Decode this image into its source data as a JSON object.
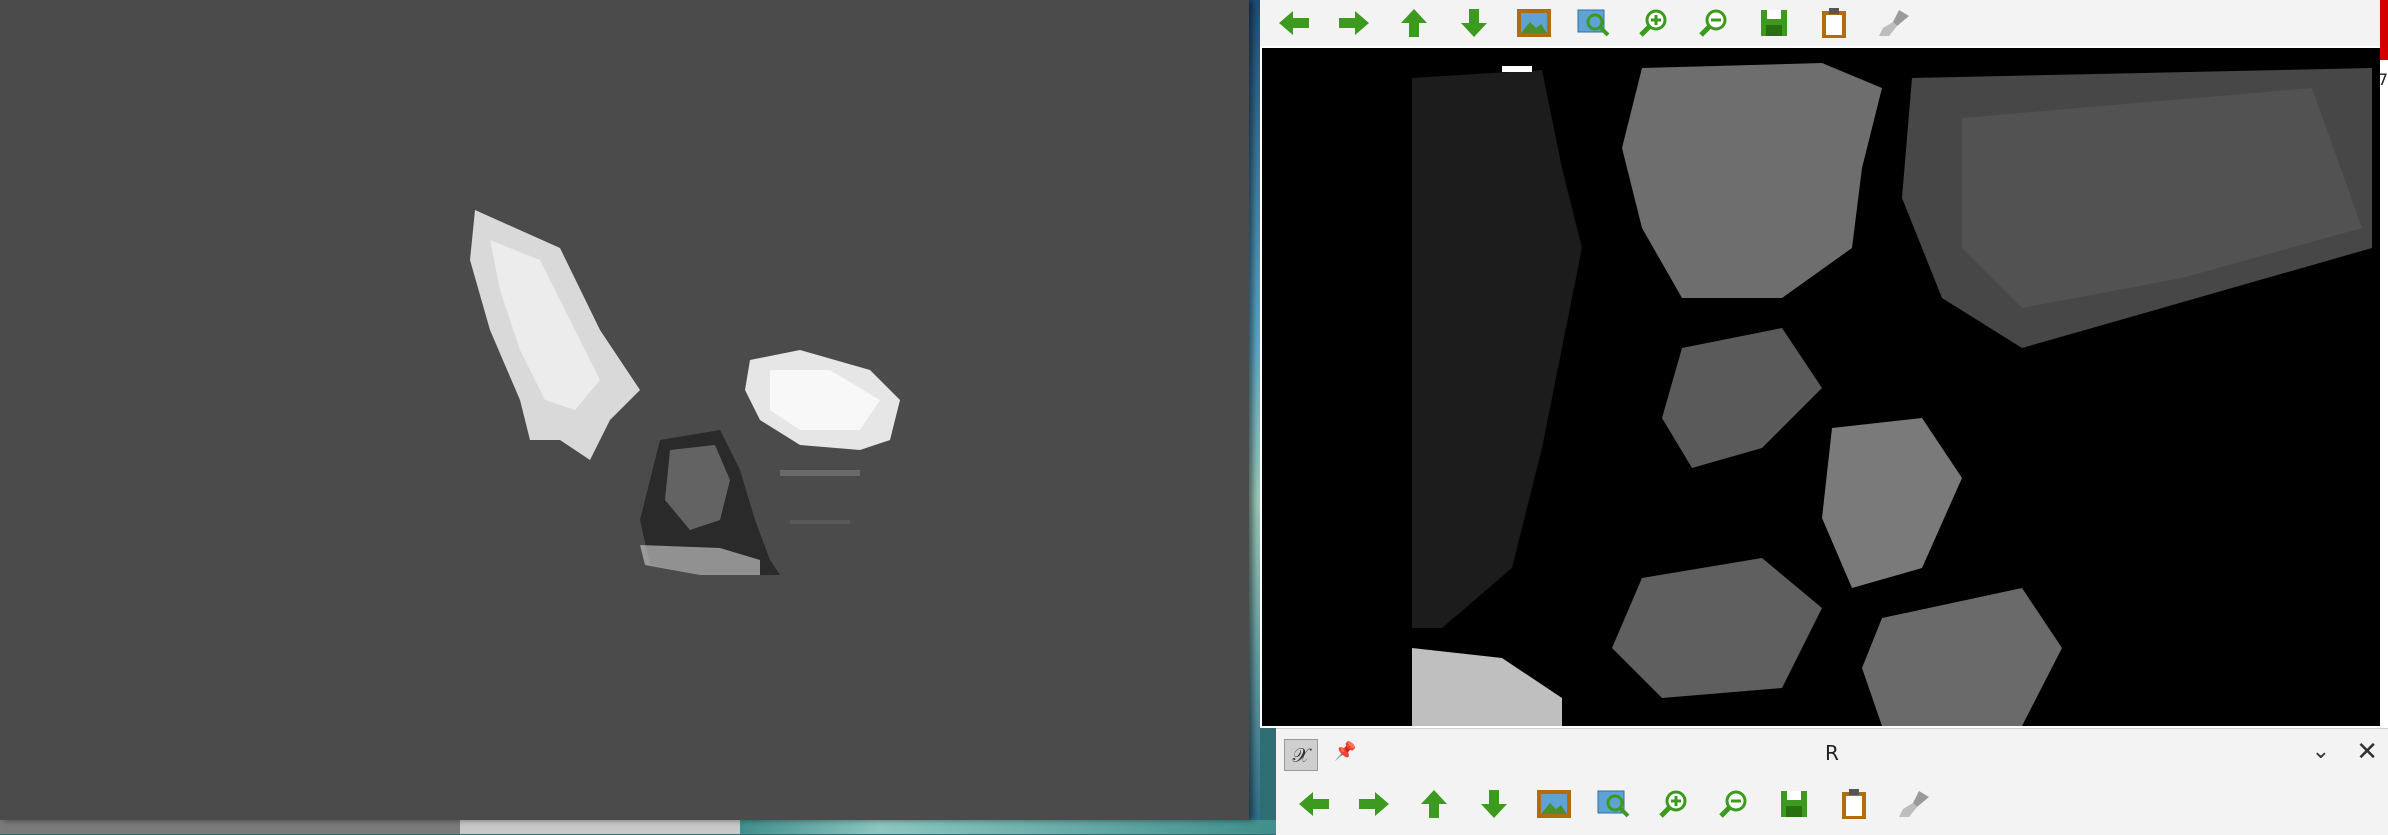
{
  "toolbar": {
    "tools": [
      {
        "icon": "arrow-left-icon",
        "label": ""
      },
      {
        "icon": "arrow-right-icon",
        "label": ""
      },
      {
        "icon": "arrow-up-icon",
        "label": ""
      },
      {
        "icon": "arrow-down-icon",
        "label": ""
      },
      {
        "icon": "image-icon",
        "label": ""
      },
      {
        "icon": "zoom-fit-icon",
        "label": ""
      },
      {
        "icon": "zoom-in-icon",
        "label": ""
      },
      {
        "icon": "zoom-out-icon",
        "label": ""
      },
      {
        "icon": "save-icon",
        "label": ""
      },
      {
        "icon": "clipboard-icon",
        "label": ""
      },
      {
        "icon": "clear-brush-icon",
        "label": ""
      }
    ]
  },
  "depth_window": {
    "edge_label": "7"
  },
  "r_window": {
    "title": "R",
    "pin_glyph": "📌",
    "chevron_glyph": "⌄",
    "close_glyph": "✕",
    "app_icon_glyph": "𝒳"
  },
  "colors": {
    "viewer_bg": "#4b4b4b",
    "toolbar_bg": "#f3f3f3",
    "tool_green": "#3c9b1e",
    "tool_brown": "#b06d10"
  }
}
